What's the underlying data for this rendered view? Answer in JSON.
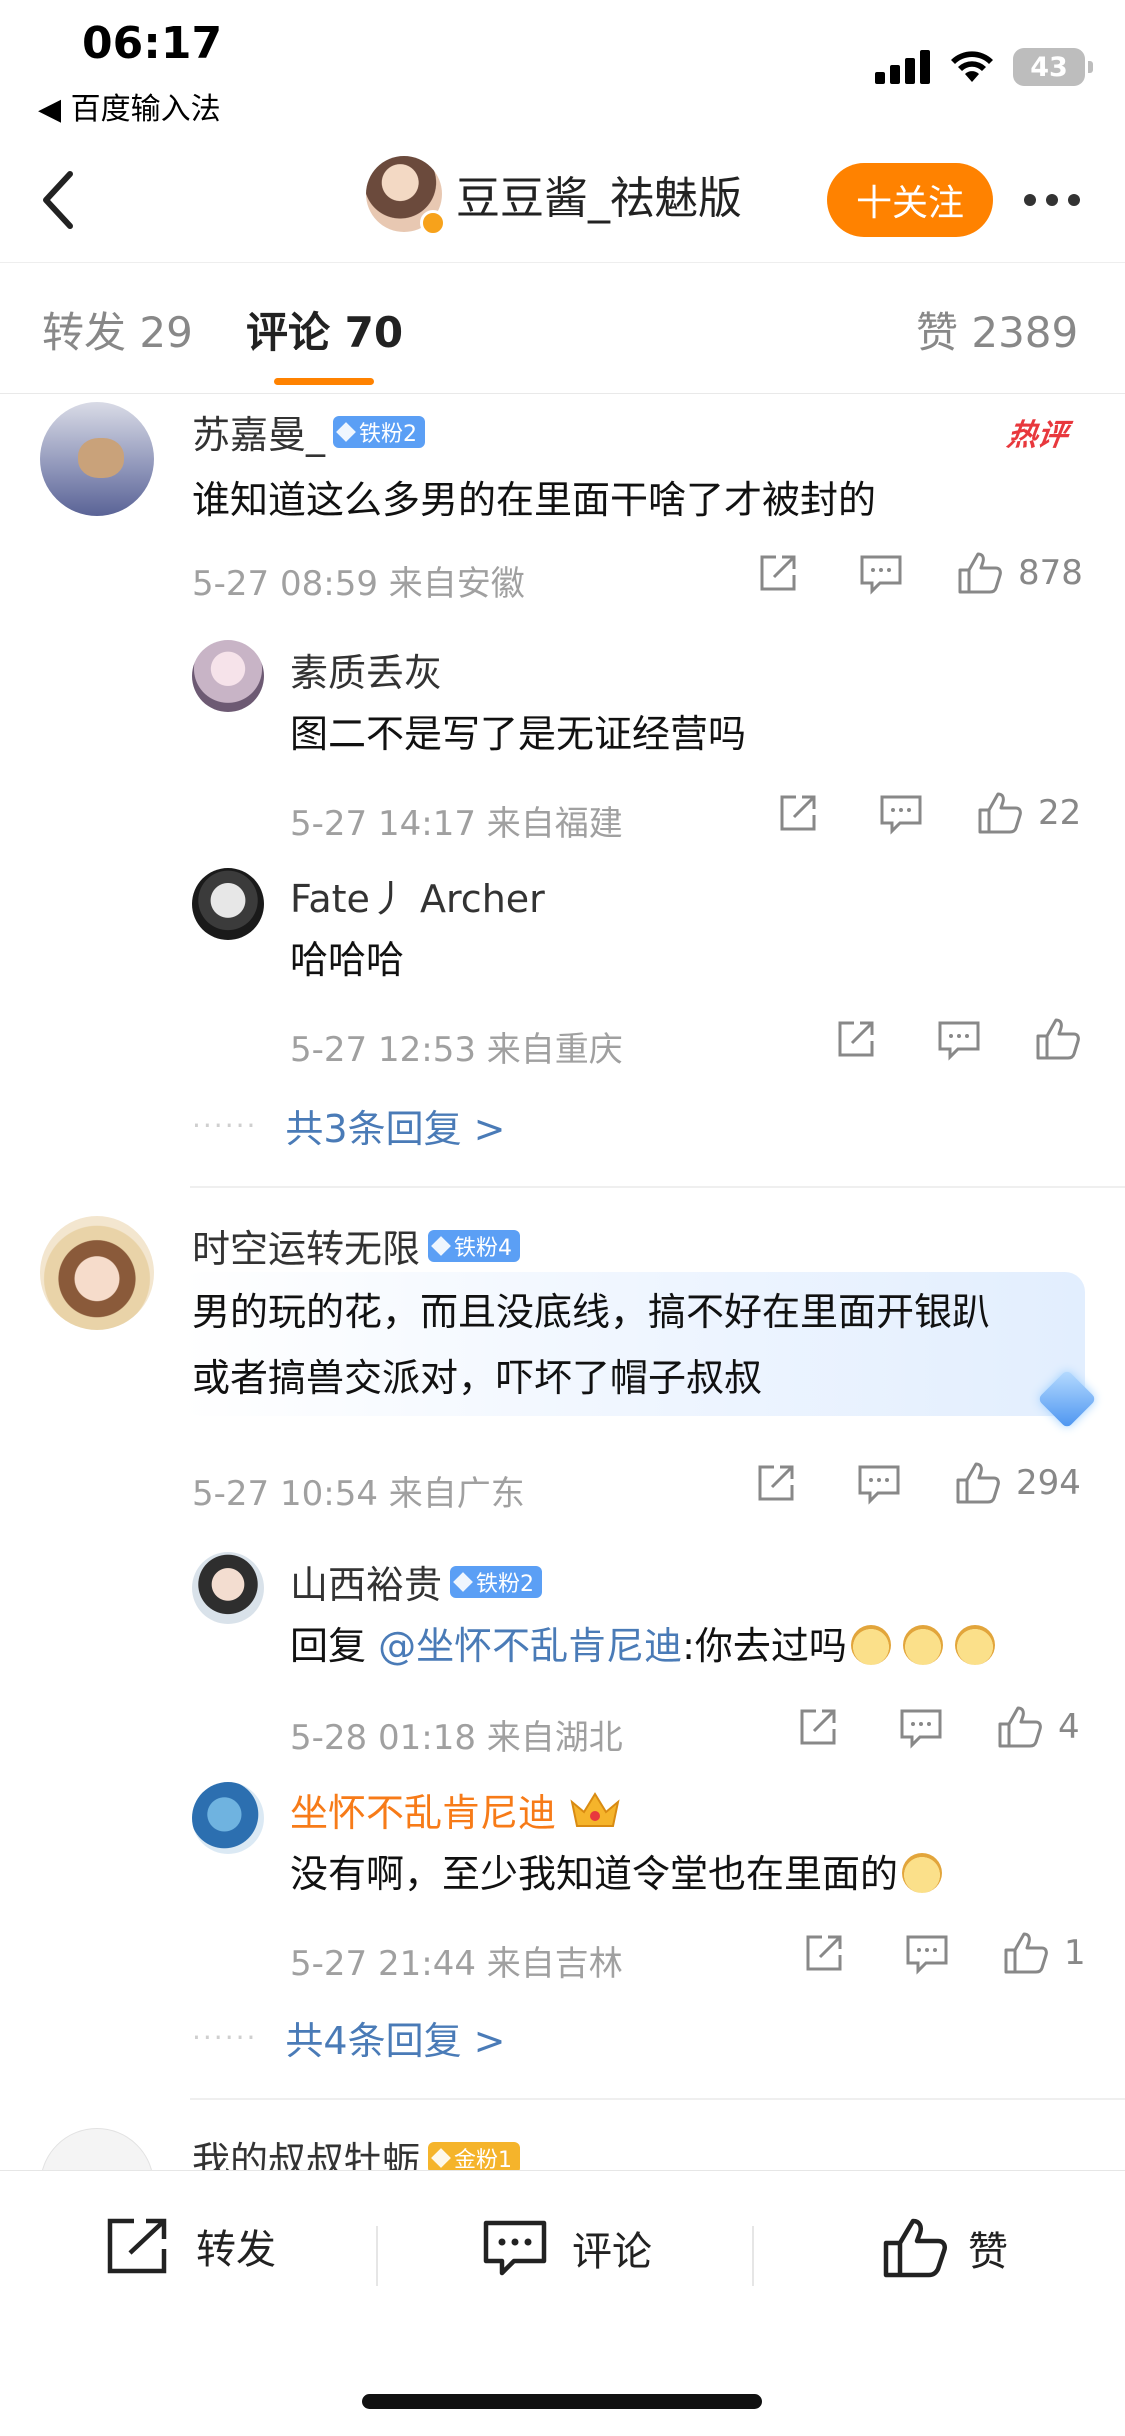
{
  "status_bar": {
    "time": "06:17",
    "back_app": "◀ 百度输入法",
    "battery": "43"
  },
  "header": {
    "name": "豆豆酱_祛魅版",
    "follow_label": "十关注"
  },
  "tabs": {
    "repost": "转发 29",
    "comments": "评论 70",
    "likes": "赞 2389"
  },
  "comments": [
    {
      "user": "苏嘉曼_",
      "badge": "铁粉2",
      "tag": "热评",
      "text": "谁知道这么多男的在里面干啥了才被封的",
      "meta": "5-27 08:59  来自安徽",
      "likes": "878",
      "replies": [
        {
          "user": "素质丢灰",
          "text": "图二不是写了是无证经营吗",
          "meta": "5-27 14:17  来自福建",
          "likes": "22"
        },
        {
          "user": "Fate丿 Archer",
          "text": "哈哈哈",
          "meta": "5-27 12:53  来自重庆",
          "likes": ""
        }
      ],
      "more": "共3条回复 >"
    },
    {
      "user": "时空运转无限",
      "badge": "铁粉4",
      "text_line1": "男的玩的花，而且没底线，搞不好在里面开银趴",
      "text_line2": "或者搞兽交派对，吓坏了帽子叔叔",
      "meta": "5-27 10:54  来自广东",
      "likes": "294",
      "replies": [
        {
          "user": "山西裕贵",
          "badge": "铁粉2",
          "text_prefix": "回复 ",
          "mention": "@坐怀不乱肯尼迪",
          "text_suffix": ":你去过吗",
          "meta": "5-28 01:18  来自湖北",
          "likes": "4"
        },
        {
          "user": "坐怀不乱肯尼迪",
          "text": "没有啊，至少我知道令堂也在里面的",
          "meta": "5-27 21:44  来自吉林",
          "likes": "1"
        }
      ],
      "more": "共4条回复 >"
    },
    {
      "user": "我的叔叔牡蛎",
      "badge": "金粉1"
    }
  ],
  "bottom_bar": {
    "repost": "转发",
    "comment": "评论",
    "like": "赞"
  },
  "colors": {
    "accent": "#ff8200",
    "link": "#4a7bb7",
    "fan_badge": "#5b9ff5",
    "gold_badge": "#f5b42b",
    "hot": "#e8383d"
  }
}
